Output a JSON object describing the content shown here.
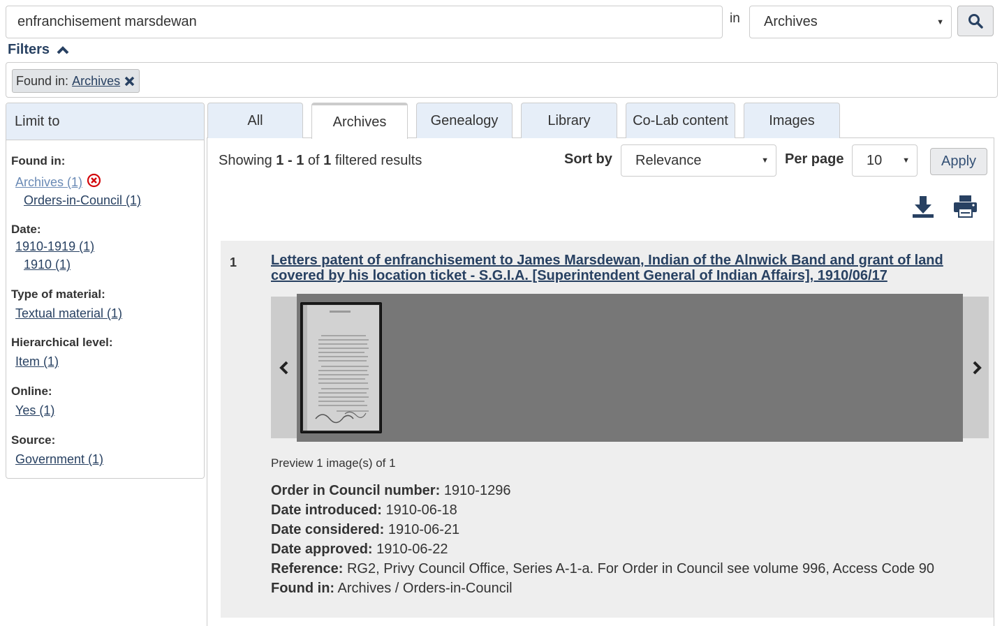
{
  "search": {
    "query": "enfranchisement marsdewan",
    "in_label": "in",
    "scope": "Archives"
  },
  "filters": {
    "toggle_label": "Filters",
    "chip_prefix": "Found in:",
    "chip_value": "Archives"
  },
  "sidebar": {
    "title": "Limit to",
    "found_in": {
      "title": "Found in:",
      "items": [
        "Archives (1)",
        "Orders-in-Council (1)"
      ]
    },
    "date": {
      "title": "Date:",
      "items": [
        "1910-1919 (1)",
        "1910 (1)"
      ]
    },
    "type": {
      "title": "Type of material:",
      "items": [
        "Textual material (1)"
      ]
    },
    "level": {
      "title": "Hierarchical level:",
      "items": [
        "Item (1)"
      ]
    },
    "online": {
      "title": "Online:",
      "items": [
        "Yes (1)"
      ]
    },
    "source": {
      "title": "Source:",
      "items": [
        "Government (1)"
      ]
    }
  },
  "tabs": [
    "All",
    "Archives",
    "Genealogy",
    "Library",
    "Co-Lab content",
    "Images"
  ],
  "active_tab": "Archives",
  "results": {
    "showing_prefix": "Showing",
    "range_start": "1",
    "range_sep": "-",
    "range_end": "1",
    "of_word": "of",
    "total": "1",
    "suffix": "filtered results",
    "sort_label": "Sort by",
    "sort_value": "Relevance",
    "per_page_label": "Per page",
    "per_page_value": "10",
    "apply_label": "Apply"
  },
  "result": {
    "number": "1",
    "title": "Letters patent of enfranchisement to James Marsdewan, Indian of the Alnwick Band and grant of land covered by his location ticket - S.G.I.A. [Superintendent General of Indian Affairs], 1910/06/17",
    "preview_caption": "Preview 1 image(s) of 1",
    "meta": [
      {
        "label": "Order in Council number:",
        "value": "1910-1296"
      },
      {
        "label": "Date introduced:",
        "value": "1910-06-18"
      },
      {
        "label": "Date considered:",
        "value": "1910-06-21"
      },
      {
        "label": "Date approved:",
        "value": "1910-06-22"
      },
      {
        "label": "Reference:",
        "value": "RG2, Privy Council Office, Series A-1-a. For Order in Council see volume 996, Access Code 90"
      },
      {
        "label": "Found in:",
        "value": "Archives / Orders-in-Council"
      }
    ]
  },
  "colors": {
    "link": "#284162",
    "tab_bg": "#e6eef8",
    "card_bg": "#eeeeee",
    "remove_icon": "#d3080c"
  }
}
